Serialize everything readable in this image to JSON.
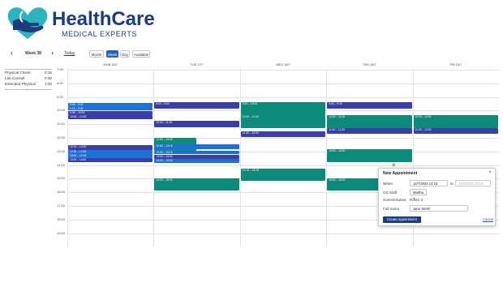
{
  "brand": {
    "name": "HealthCare",
    "tagline": "MEDICAL EXPERTS",
    "primary_color": "#1c3c7d",
    "accent_color": "#2bb3c0"
  },
  "toolbar": {
    "prev_icon": "chevron-left-icon",
    "next_icon": "chevron-right-icon",
    "week_label": "Week 38",
    "today_label": "Today",
    "views": [
      {
        "label": "Month",
        "active": false
      },
      {
        "label": "Week",
        "active": true
      },
      {
        "label": "Day",
        "active": false
      },
      {
        "label": "Available",
        "active": false
      }
    ]
  },
  "legend": [
    {
      "name": "Physical Check",
      "duration": "0:15"
    },
    {
      "name": "Lab Consult",
      "duration": "0:30"
    },
    {
      "name": "Extended Physical",
      "duration": "1:00"
    }
  ],
  "calendar": {
    "days": [
      "MON 16/7",
      "TUE 17/7",
      "WED 18/7",
      "THU 19/7",
      "FRI 14/7"
    ],
    "times": [
      "7:00",
      "8:00",
      "9:00",
      "10:00",
      "11:00",
      "12:00",
      "13:00",
      "14:00",
      "15:00",
      "16:00",
      "17:00",
      "18:00",
      "19:00"
    ],
    "events": [
      {
        "day": 0,
        "start": 9.45,
        "end": 9.75,
        "label": "9:45 – 9:30",
        "color": "blue"
      },
      {
        "day": 0,
        "start": 9.75,
        "end": 10.0,
        "label": "9:15 – 9:30",
        "color": "blue"
      },
      {
        "day": 0,
        "start": 10.05,
        "end": 10.35,
        "label": "9:45 – 10:00",
        "color": "navy"
      },
      {
        "day": 0,
        "start": 10.35,
        "end": 10.65,
        "label": "10:00 – 10:15",
        "color": "navy"
      },
      {
        "day": 0,
        "start": 12.55,
        "end": 12.9,
        "label": "12:00 – 13:00",
        "color": "navy"
      },
      {
        "day": 0,
        "start": 12.9,
        "end": 13.2,
        "label": "12:30 – 12:45",
        "color": "blue"
      },
      {
        "day": 0,
        "start": 13.2,
        "end": 13.5,
        "label": "13:00 – 13:15",
        "color": "blue"
      },
      {
        "day": 0,
        "start": 13.5,
        "end": 13.8,
        "label": "13:00 – 14:00",
        "color": "navy"
      },
      {
        "day": 1,
        "start": 9.4,
        "end": 9.9,
        "label": "8:00 – 9:00",
        "color": "navy"
      },
      {
        "day": 1,
        "start": 10.75,
        "end": 11.25,
        "label": "10:00 – 11:00",
        "color": "navy"
      },
      {
        "day": 1,
        "start": 12.0,
        "end": 13.0,
        "label": "12:00 – 14:00",
        "color": "teal"
      },
      {
        "day": 1,
        "start": 12.5,
        "end": 12.85,
        "label": "13:00 – 13:15",
        "color": "blue"
      },
      {
        "day": 1,
        "start": 12.95,
        "end": 13.25,
        "label": "13:00 – 13:15",
        "color": "blue"
      },
      {
        "day": 1,
        "start": 13.25,
        "end": 13.55,
        "label": "13:00 – 14:00",
        "color": "navy"
      },
      {
        "day": 1,
        "start": 13.55,
        "end": 13.85,
        "label": "13:00 – 13:30",
        "color": "blue"
      },
      {
        "day": 1,
        "start": 14.95,
        "end": 15.9,
        "label": "15:00 – 16:00",
        "color": "teal"
      },
      {
        "day": 2,
        "start": 9.4,
        "end": 10.35,
        "label": "9:00 – 10:00",
        "color": "teal"
      },
      {
        "day": 2,
        "start": 10.35,
        "end": 11.3,
        "label": "10:00 – 11:00",
        "color": "teal"
      },
      {
        "day": 2,
        "start": 11.5,
        "end": 11.95,
        "label": "11:30 – 12:00",
        "color": "navy"
      },
      {
        "day": 2,
        "start": 14.25,
        "end": 15.2,
        "label": "14:15 – 15:15",
        "color": "teal"
      },
      {
        "day": 3,
        "start": 9.4,
        "end": 9.9,
        "label": "9:00 – 9:30",
        "color": "navy"
      },
      {
        "day": 3,
        "start": 10.35,
        "end": 11.3,
        "label": "10:00 – 11:00",
        "color": "teal"
      },
      {
        "day": 3,
        "start": 11.3,
        "end": 11.75,
        "label": "11:00 – 11:30",
        "color": "navy"
      },
      {
        "day": 3,
        "start": 12.85,
        "end": 13.8,
        "label": "13:00 – 14:00",
        "color": "teal"
      },
      {
        "day": 3,
        "start": 14.95,
        "end": 15.9,
        "label": "15:00 – 16:00",
        "color": "teal"
      },
      {
        "day": 4,
        "start": 10.35,
        "end": 11.3,
        "label": "10:00 – 11:00",
        "color": "teal"
      },
      {
        "day": 4,
        "start": 11.3,
        "end": 11.75,
        "label": "11:30 – 12:00",
        "color": "navy"
      }
    ]
  },
  "popup": {
    "title": "New Appointment",
    "close_icon": "close-icon",
    "when_label": "When",
    "when_start": "14/7/2023 14:15",
    "to_label": "to",
    "when_end_placeholder": "14/7/2023 15:15",
    "staff_label": "OS Staff",
    "staff_value": "Martha",
    "suite_label": "SummitSuites",
    "suite_value": "Room 3",
    "name_label": "Full name",
    "name_value": "Jane Smith",
    "create_label": "Create Appointment",
    "cancel_label": "Cancel"
  }
}
